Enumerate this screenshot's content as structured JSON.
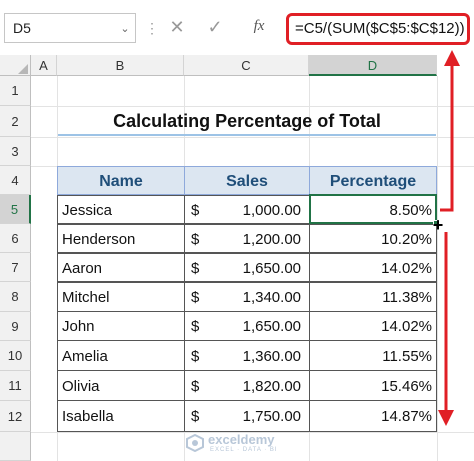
{
  "formula_bar": {
    "name_box": "D5",
    "name_caret": "⌄",
    "dots": "⋮",
    "cancel": "✕",
    "enter": "✓",
    "fx": "fx",
    "formula": "=C5/(SUM($C$5:$C$12))"
  },
  "columns": [
    "A",
    "B",
    "C",
    "D"
  ],
  "rows": [
    "1",
    "2",
    "3",
    "4",
    "5",
    "6",
    "7",
    "8",
    "9",
    "10",
    "11",
    "12"
  ],
  "sheet": {
    "title": "Calculating Percentage of Total",
    "headers": {
      "name": "Name",
      "sales": "Sales",
      "percentage": "Percentage"
    },
    "data": [
      {
        "name": "Jessica",
        "currency": "$",
        "sales": "1,000.00",
        "percentage": "8.50%"
      },
      {
        "name": "Henderson",
        "currency": "$",
        "sales": "1,200.00",
        "percentage": "10.20%"
      },
      {
        "name": "Aaron",
        "currency": "$",
        "sales": "1,650.00",
        "percentage": "14.02%"
      },
      {
        "name": "Mitchel",
        "currency": "$",
        "sales": "1,340.00",
        "percentage": "11.38%"
      },
      {
        "name": "John",
        "currency": "$",
        "sales": "1,650.00",
        "percentage": "14.02%"
      },
      {
        "name": "Amelia",
        "currency": "$",
        "sales": "1,360.00",
        "percentage": "11.55%"
      },
      {
        "name": "Olivia",
        "currency": "$",
        "sales": "1,820.00",
        "percentage": "15.46%"
      },
      {
        "name": "Isabella",
        "currency": "$",
        "sales": "1,750.00",
        "percentage": "14.87%"
      }
    ]
  },
  "selected": {
    "column": "D",
    "row": "5"
  },
  "watermark": {
    "brand": "exceldemy",
    "tagline": "EXCEL · DATA · BI"
  },
  "colors": {
    "accent_green": "#217346",
    "arrow_red": "#e01f25",
    "header_fill": "#dce6f1",
    "header_text": "#1f4e79"
  }
}
